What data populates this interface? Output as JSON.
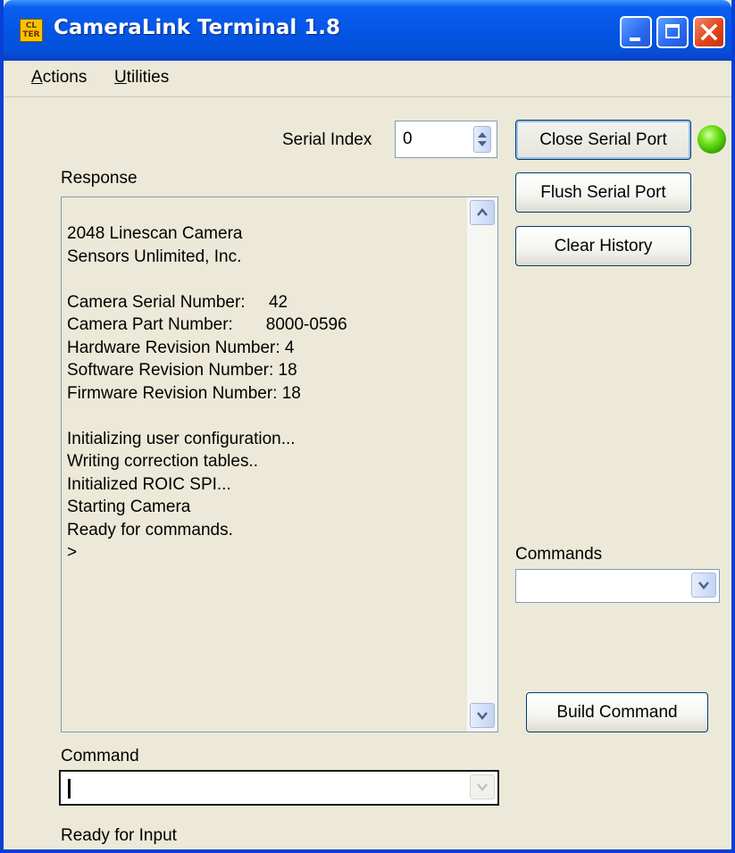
{
  "window": {
    "title": "CameraLink Terminal 1.8",
    "icon_text_top": "CL",
    "icon_text_bottom": "TER"
  },
  "menu": {
    "items": [
      {
        "label": "Actions"
      },
      {
        "label": "Utilities"
      }
    ]
  },
  "serial": {
    "index_label": "Serial Index",
    "index_value": "0",
    "status_color": "#3cc40c"
  },
  "buttons": {
    "close_serial_port": "Close Serial Port",
    "flush_serial_port": "Flush Serial Port",
    "clear_history": "Clear History",
    "build_command": "Build Command"
  },
  "response": {
    "label": "Response",
    "text": "2048 Linescan Camera\nSensors Unlimited, Inc.\n\nCamera Serial Number:     42\nCamera Part Number:       8000-0596\nHardware Revision Number: 4\nSoftware Revision Number: 18\nFirmware Revision Number: 18\n\nInitializing user configuration...\nWriting correction tables..\nInitialized ROIC SPI...\nStarting Camera\nReady for commands.\n>"
  },
  "commands": {
    "label": "Commands",
    "selected": ""
  },
  "command": {
    "label": "Command",
    "value": ""
  },
  "status": {
    "text": "Ready for Input"
  },
  "colors": {
    "titlebar": "#0456e6",
    "window_bg": "#ece9d8",
    "border": "#0a3fd6"
  }
}
